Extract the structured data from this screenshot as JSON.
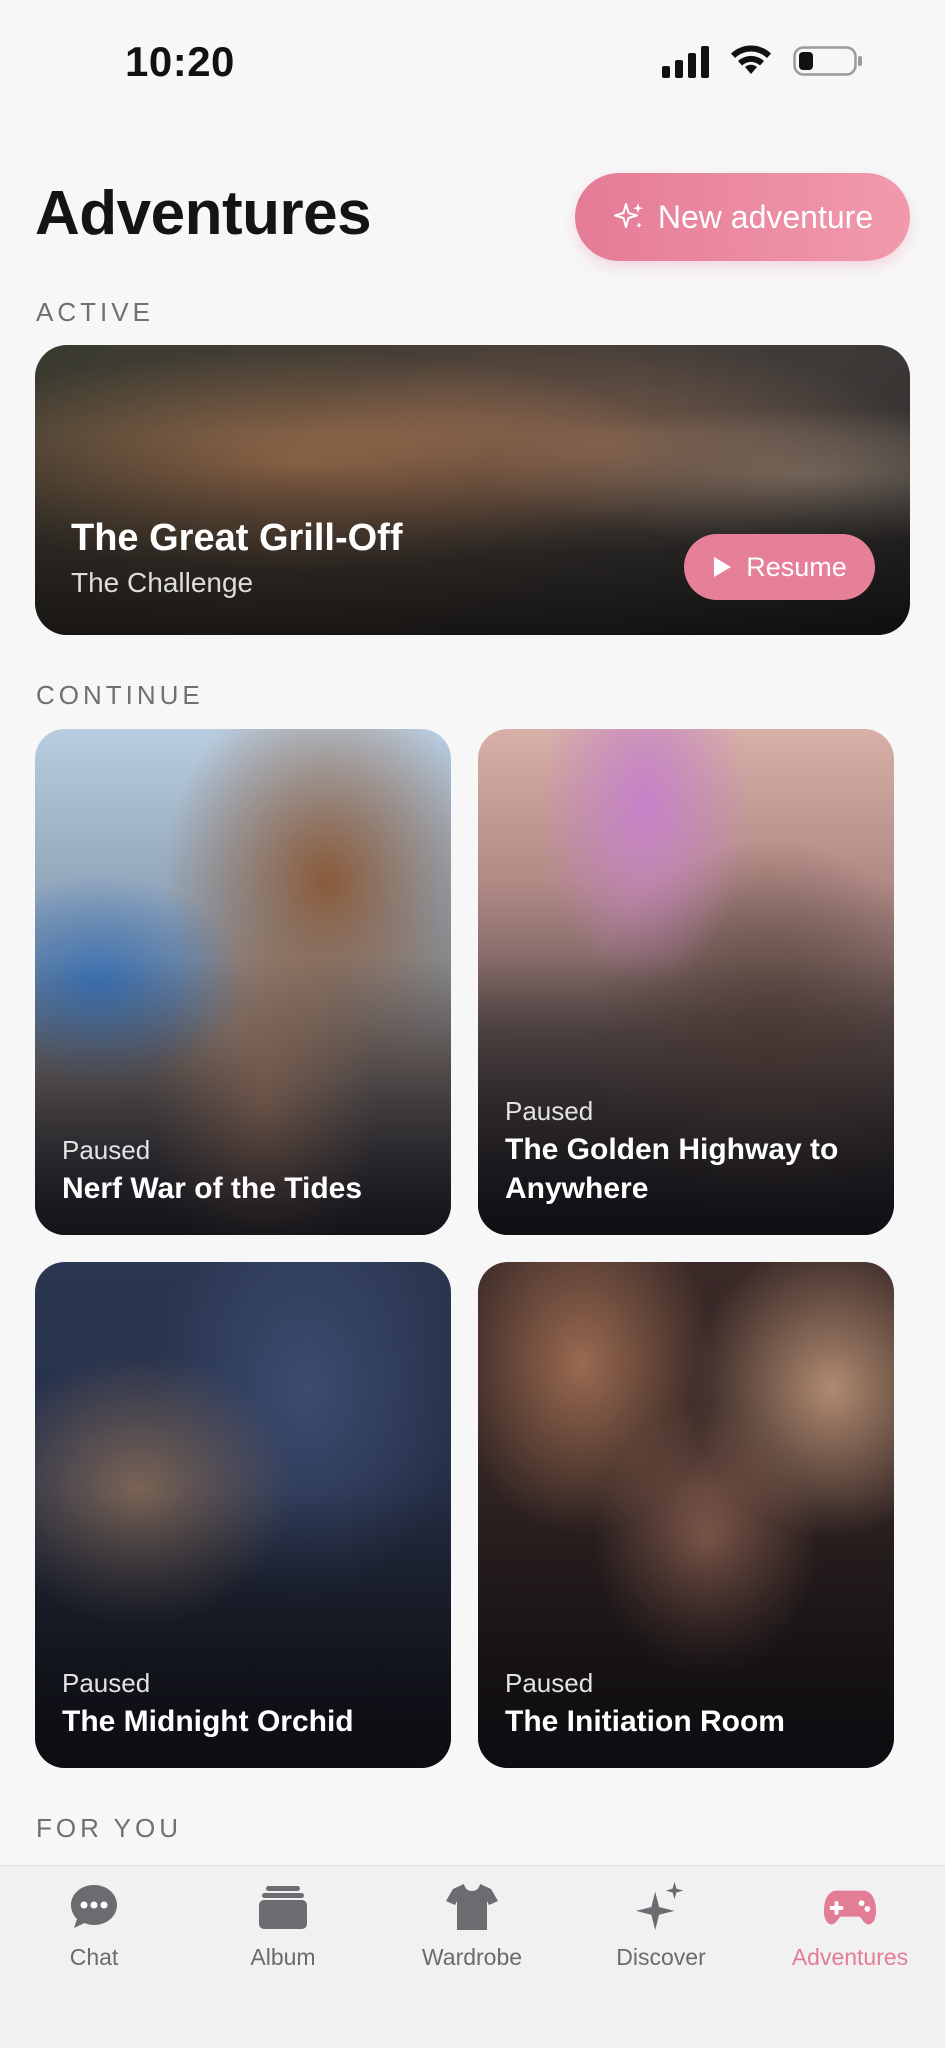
{
  "status_bar": {
    "time": "10:20"
  },
  "header": {
    "title": "Adventures",
    "new_button_label": "New adventure"
  },
  "sections": {
    "active": "ACTIVE",
    "continue": "CONTINUE",
    "for_you": "FOR YOU"
  },
  "active_adventure": {
    "title": "The Great Grill-Off",
    "subtitle": "The Challenge",
    "resume_label": "Resume"
  },
  "continue_cards": [
    {
      "status": "Paused",
      "title": "Nerf War of the Tides"
    },
    {
      "status": "Paused",
      "title": "The Golden Highway to Anywhere"
    },
    {
      "status": "Paused",
      "title": "The Midnight Orchid"
    },
    {
      "status": "Paused",
      "title": "The Initiation Room"
    }
  ],
  "tab_bar": {
    "items": [
      {
        "label": "Chat",
        "icon": "chat-bubble-icon"
      },
      {
        "label": "Album",
        "icon": "album-stack-icon"
      },
      {
        "label": "Wardrobe",
        "icon": "shirt-icon"
      },
      {
        "label": "Discover",
        "icon": "sparkles-icon"
      },
      {
        "label": "Adventures",
        "icon": "gamepad-icon"
      }
    ],
    "active_index": 4
  },
  "colors": {
    "accent": "#e57b96",
    "tab_inactive": "#6b6b70",
    "background": "#f7f7f8"
  }
}
